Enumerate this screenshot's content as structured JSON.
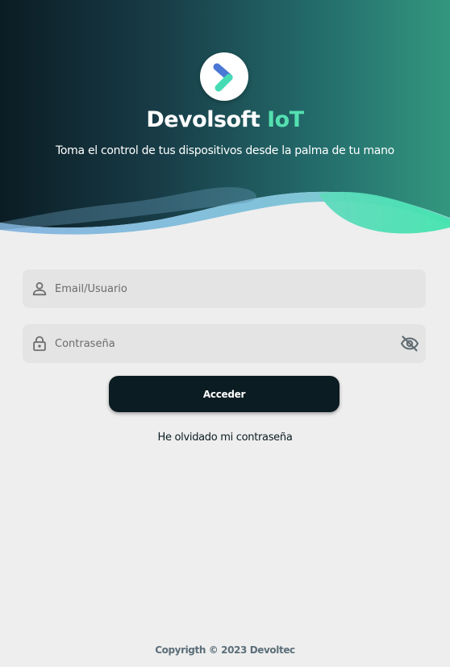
{
  "header": {
    "title_main": "Devolsoft",
    "title_accent": "IoT",
    "tagline": "Toma el control de tus dispositivos desde la palma de tu mano",
    "logo_icon": "chevron-right-logo-icon"
  },
  "form": {
    "email_placeholder": "Email/Usuario",
    "email_value": "",
    "email_icon": "person-icon",
    "password_placeholder": "Contraseña",
    "password_value": "",
    "password_icon": "lock-icon",
    "toggle_icon": "eye-off-icon",
    "login_label": "Acceder",
    "forgot_label": "He olvidado mi contraseña"
  },
  "footer": {
    "copyright": "Copyrigth © 2023 Devoltec"
  },
  "colors": {
    "primary_dark": "#0b1c22",
    "accent": "#54dfb0",
    "hero_teal": "#2e8f7c",
    "wave_blue": "#7ab6df",
    "background": "#eeeeee",
    "field_bg": "#e4e4e4"
  }
}
